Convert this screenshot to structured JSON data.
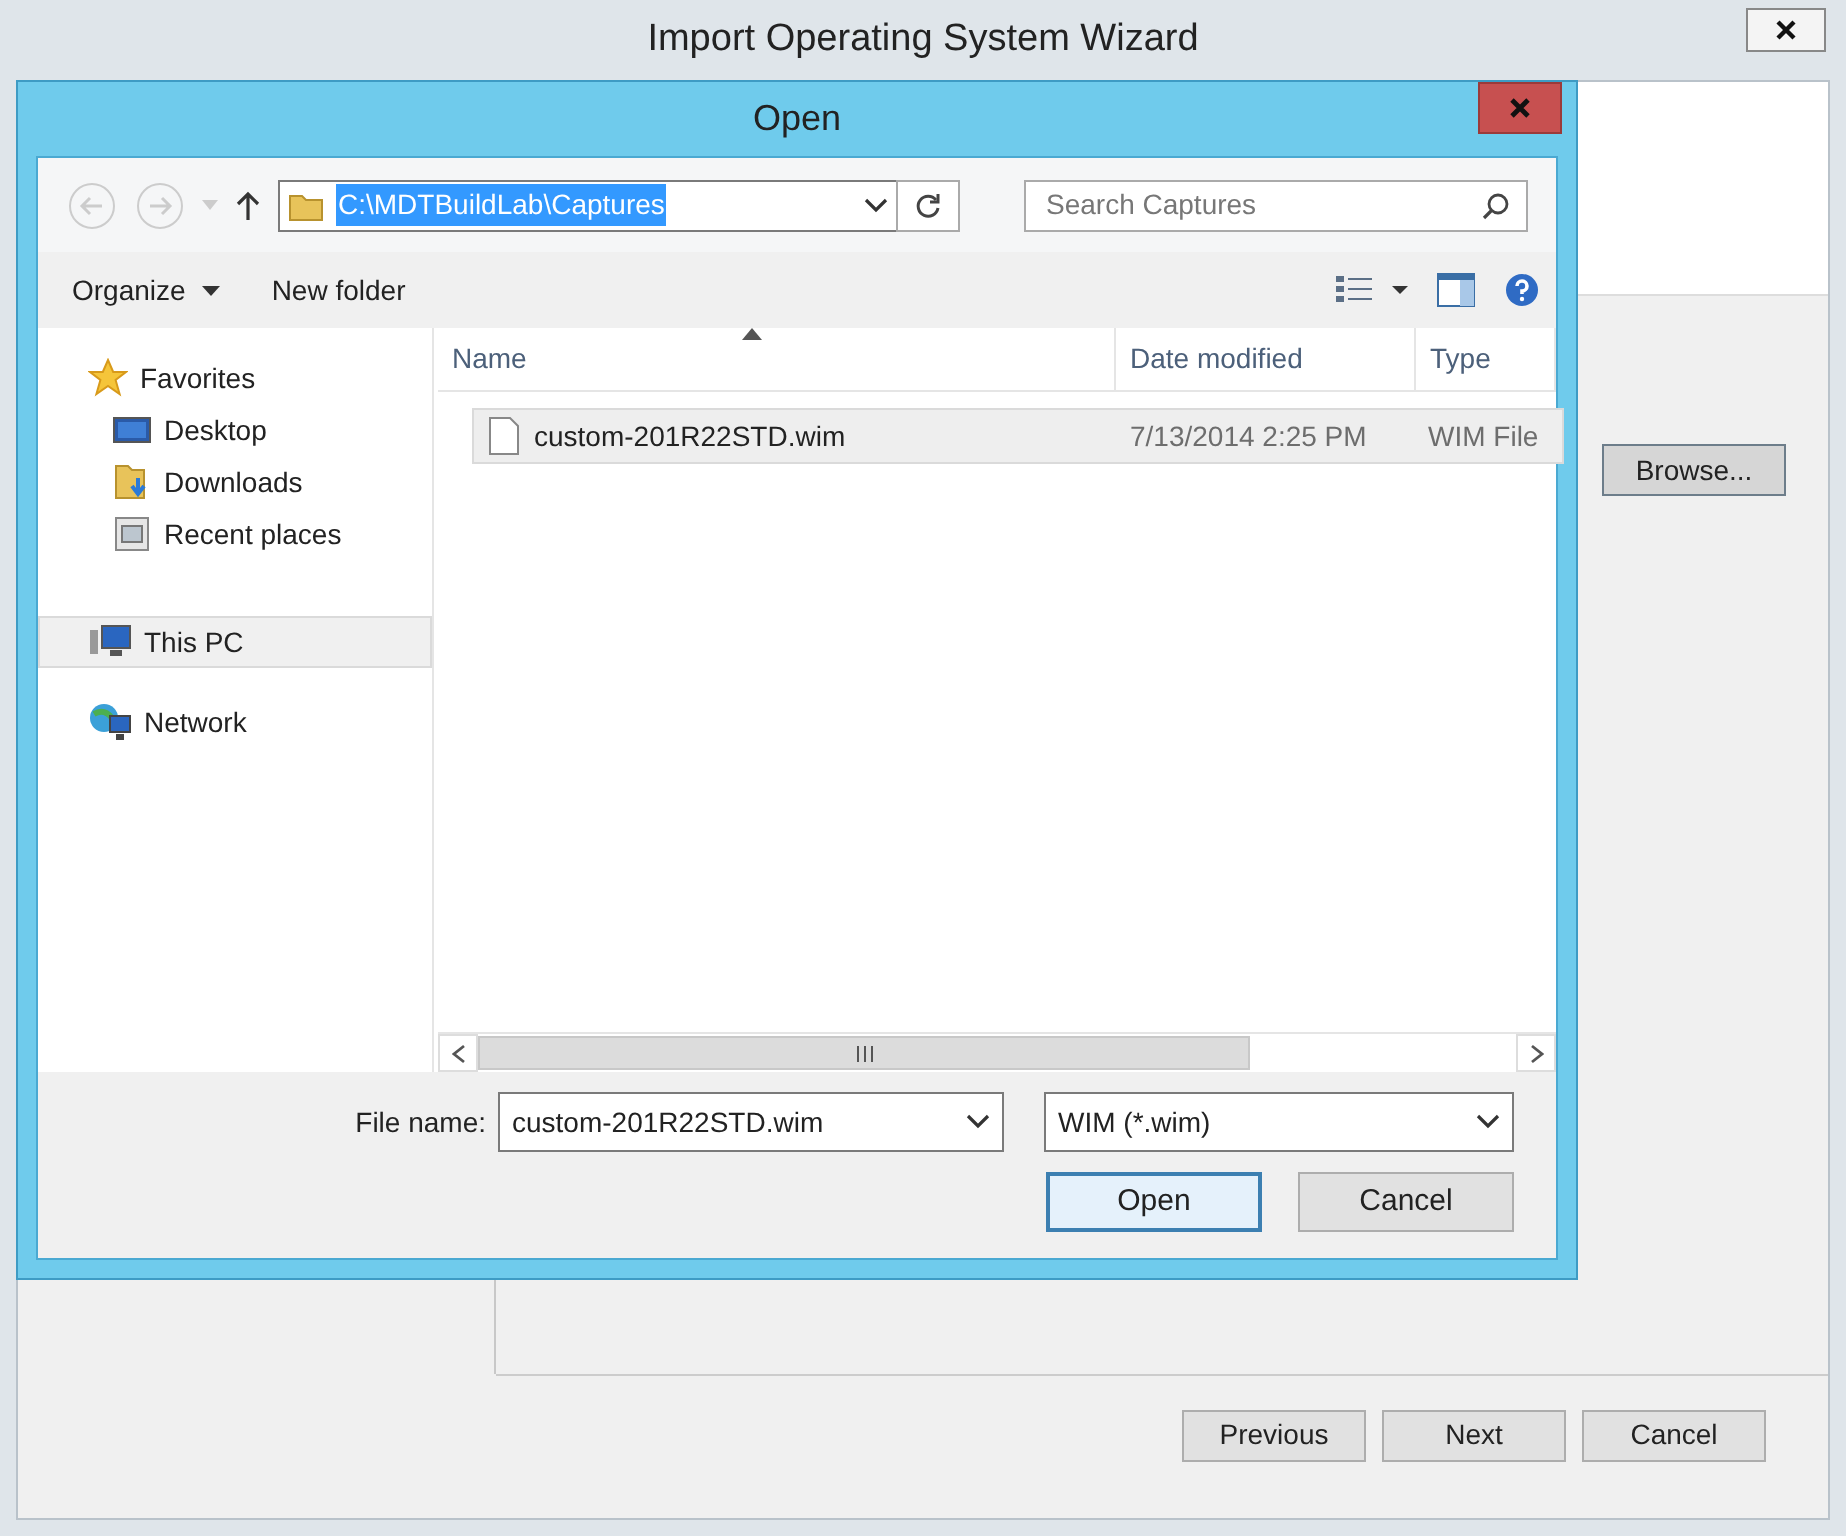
{
  "wizard": {
    "title": "Import Operating System Wizard",
    "browse_button": "Browse...",
    "buttons": [
      "Previous",
      "Next",
      "Cancel"
    ]
  },
  "dialog": {
    "title": "Open",
    "address": {
      "value": "C:\\MDTBuildLab\\Captures",
      "selected": true
    },
    "search": {
      "placeholder": "Search Captures"
    },
    "commands": [
      {
        "label": "Organize",
        "kind": "menu"
      },
      {
        "label": "New folder",
        "kind": "plain"
      }
    ],
    "nav": [
      {
        "label": "Favorites",
        "kind": "star",
        "selected": false,
        "children": [
          {
            "label": "Desktop",
            "kind": "desktop",
            "selected": false
          },
          {
            "label": "Downloads",
            "kind": "downloads",
            "selected": false
          },
          {
            "label": "Recent places",
            "kind": "recent",
            "selected": false
          }
        ]
      },
      {
        "label": "This PC",
        "kind": "computer",
        "selected": true
      },
      {
        "label": "Network",
        "kind": "network",
        "selected": false
      }
    ],
    "columns": [
      {
        "label": "Name",
        "sorted": true
      },
      {
        "label": "Date modified",
        "sorted": false
      },
      {
        "label": "Type",
        "sorted": false
      }
    ],
    "rows": [
      {
        "name": "custom-201R22STD.wim",
        "date": "7/13/2014 2:25 PM",
        "type": "WIM File",
        "selected": true
      }
    ],
    "file_name": {
      "label": "File name:",
      "value": "custom-201R22STD.wim"
    },
    "filter": {
      "value": "WIM (*.wim)"
    },
    "buttons": [
      {
        "label": "Open",
        "default": true
      },
      {
        "label": "Cancel",
        "default": false
      }
    ]
  }
}
